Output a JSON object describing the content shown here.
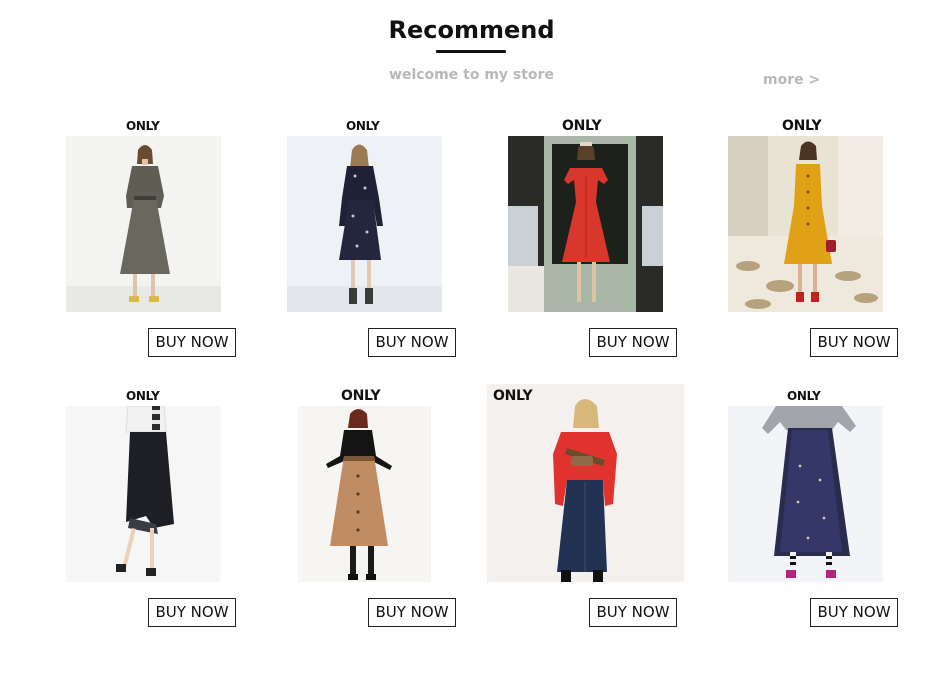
{
  "header": {
    "title": "Recommend",
    "subtitle": "welcome to my store",
    "more_label": "more >"
  },
  "products": [
    {
      "brand": "ONLY",
      "buy_label": "BUY NOW",
      "item": "grey wrap midi dress",
      "main_color": "#5f5d54"
    },
    {
      "brand": "ONLY",
      "buy_label": "BUY NOW",
      "item": "navy floral dress",
      "main_color": "#1f2236"
    },
    {
      "brand": "ONLY",
      "buy_label": "BUY NOW",
      "item": "red button dress",
      "main_color": "#d8372c"
    },
    {
      "brand": "ONLY",
      "buy_label": "BUY NOW",
      "item": "mustard ruffle dress",
      "main_color": "#e0a116"
    },
    {
      "brand": "ONLY",
      "buy_label": "BUY NOW",
      "item": "black midi skirt",
      "main_color": "#1d1f24"
    },
    {
      "brand": "ONLY",
      "buy_label": "BUY NOW",
      "item": "camel button skirt",
      "main_color": "#c08c63"
    },
    {
      "brand": "ONLY",
      "buy_label": "BUY NOW",
      "item": "denim skirt with red top",
      "main_color": "#213252"
    },
    {
      "brand": "ONLY",
      "buy_label": "BUY NOW",
      "item": "navy tulle skirt",
      "main_color": "#2a2c4e"
    }
  ],
  "colors": {
    "text": "#111111",
    "muted": "#b8b8b8",
    "border": "#222222",
    "background": "#ffffff"
  }
}
